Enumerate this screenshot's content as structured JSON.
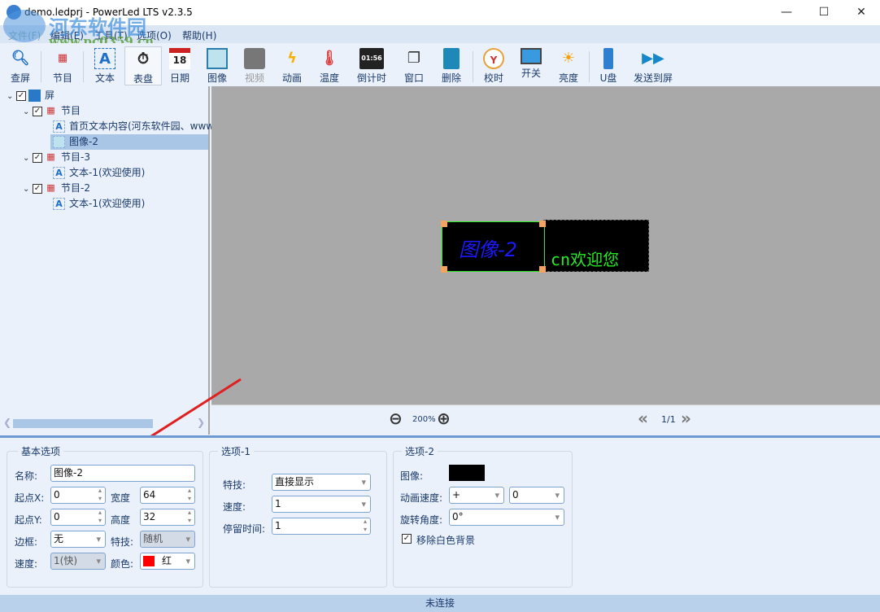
{
  "window": {
    "title": "demo.ledprj - PowerLed LTS v2.3.5",
    "minimize": "—",
    "maximize": "☐",
    "close": "✕"
  },
  "watermark": {
    "name": "河东软件园",
    "url": "www.pc0359.cn"
  },
  "menu": [
    "文件(F)",
    "编辑(E)",
    "工具(T)",
    "选项(O)",
    "帮助(H)"
  ],
  "toolbar": [
    {
      "label": "查屏",
      "icon": "search-icon"
    },
    {
      "label": "节目",
      "icon": "program-icon"
    },
    {
      "label": "文本",
      "icon": "text-icon"
    },
    {
      "label": "表盘",
      "icon": "clock-dial-icon"
    },
    {
      "label": "日期",
      "icon": "calendar-icon"
    },
    {
      "label": "图像",
      "icon": "image-icon"
    },
    {
      "label": "视频",
      "icon": "video-icon"
    },
    {
      "label": "动画",
      "icon": "animation-icon"
    },
    {
      "label": "温度",
      "icon": "thermometer-icon"
    },
    {
      "label": "倒计时",
      "icon": "countdown-icon"
    },
    {
      "label": "窗口",
      "icon": "window-icon"
    },
    {
      "label": "删除",
      "icon": "trash-icon"
    },
    {
      "label": "校时",
      "icon": "clock-icon"
    },
    {
      "label": "开关",
      "icon": "monitor-icon"
    },
    {
      "label": "亮度",
      "icon": "brightness-icon"
    },
    {
      "label": "U盘",
      "icon": "usb-icon"
    },
    {
      "label": "发送到屏",
      "icon": "send-icon"
    }
  ],
  "tree": {
    "root": "屏",
    "nodes": [
      {
        "label": "节目",
        "level": 1,
        "type": "program"
      },
      {
        "label": "首页文本内容(河东软件园、www",
        "level": 2,
        "type": "text"
      },
      {
        "label": "图像-2",
        "level": 2,
        "type": "image",
        "selected": true
      },
      {
        "label": "节目-3",
        "level": 1,
        "type": "program"
      },
      {
        "label": "文本-1(欢迎使用)",
        "level": 2,
        "type": "text"
      },
      {
        "label": "节目-2",
        "level": 1,
        "type": "program"
      },
      {
        "label": "文本-1(欢迎使用)",
        "level": 2,
        "type": "text"
      }
    ]
  },
  "preview": {
    "image_text": "图像-2",
    "text_item": "cn欢迎您"
  },
  "zoom": {
    "level": "200%"
  },
  "pager": {
    "page": "1/1"
  },
  "basic": {
    "title": "基本选项",
    "name_label": "名称:",
    "name": "图像-2",
    "x_label": "起点X:",
    "x": "0",
    "width_label": "宽度",
    "width": "64",
    "y_label": "起点Y:",
    "y": "0",
    "height_label": "高度",
    "height": "32",
    "border_label": "边框:",
    "border": "无",
    "effect_label": "特技:",
    "effect": "随机",
    "speed_label": "速度:",
    "speed": "1(快)",
    "color_label": "颜色:",
    "color": "红",
    "color_hex": "#ff0000"
  },
  "opt1": {
    "title": "选项-1",
    "effect_label": "特技:",
    "effect": "直接显示",
    "speed_label": "速度:",
    "speed": "1",
    "stay_label": "停留时间:",
    "stay": "1"
  },
  "opt2": {
    "title": "选项-2",
    "image_label": "图像:",
    "anim_label": "动画速度:",
    "anim_sign": "+",
    "anim_value": "0",
    "rotate_label": "旋转角度:",
    "rotate": "0°",
    "remove_white_label": "移除白色背景",
    "remove_white": true
  },
  "status": "未连接"
}
